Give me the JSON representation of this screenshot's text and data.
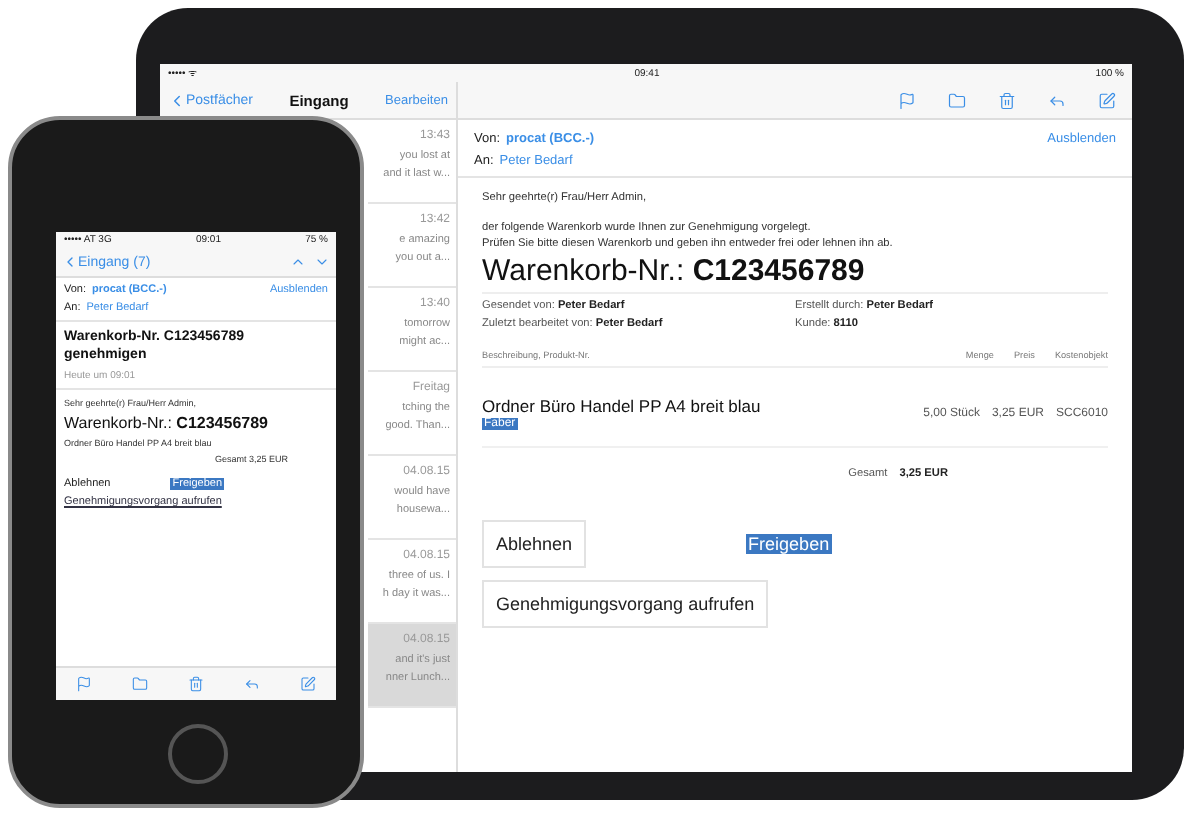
{
  "tablet": {
    "status_bar": {
      "signal": "••••• ᯤ",
      "time": "09:41",
      "battery": "100 %"
    },
    "mailbox": {
      "back": "Postfächer",
      "title": "Eingang",
      "edit": "Bearbeiten",
      "items": [
        {
          "time": "13:43",
          "lines": [
            "you lost at",
            "and it last w..."
          ],
          "selected": false
        },
        {
          "time": "13:42",
          "lines": [
            "e amazing",
            "you out a..."
          ],
          "selected": false
        },
        {
          "time": "13:40",
          "lines": [
            "tomorrow",
            "might ac..."
          ],
          "selected": false
        },
        {
          "time": "Freitag",
          "lines": [
            "tching the",
            "good. Than..."
          ],
          "selected": false
        },
        {
          "time": "04.08.15",
          "lines": [
            "would have",
            "housewa..."
          ],
          "selected": false
        },
        {
          "time": "04.08.15",
          "lines": [
            "three of us. I",
            "h day it was..."
          ],
          "selected": false
        },
        {
          "time": "04.08.15",
          "lines": [
            "and it's just",
            "nner Lunch..."
          ],
          "selected": true
        }
      ]
    },
    "message": {
      "from_label": "Von:",
      "from": "procat (BCC.-)",
      "hide": "Ausblenden",
      "to_label": "An:",
      "to": "Peter Bedarf",
      "greeting": "Sehr geehrte(r) Frau/Herr Admin,",
      "body": [
        "der folgende Warenkorb wurde Ihnen zur Genehmigung vorgelegt.",
        "Prüfen Sie bitte diesen Warenkorb und geben ihn entweder frei oder lehnen ihn ab."
      ],
      "heading": "Warenkorb-Nr.: **C123456789**",
      "meta": [
        {
          "label": "Gesendet von:",
          "value": "Peter Bedarf"
        },
        {
          "label": "Erstellt durch:",
          "value": "Peter Bedarf"
        },
        {
          "label": "Zuletzt bearbeitet von:",
          "value": "Peter Bedarf"
        },
        {
          "label": "Kunde:",
          "value": "8110"
        }
      ],
      "columns": [
        "Beschreibung, Produkt-Nr.",
        "Menge",
        "Preis",
        "Kostenobjekt"
      ],
      "row": {
        "description": "Ordner Büro Handel PP A4 breit blau",
        "tag": "Faber",
        "quantity": "5,00 Stück",
        "price": "3,25 EUR",
        "cost_object": "SCC6010"
      },
      "total_label": "Gesamt",
      "total": "3,25 EUR",
      "buttons": [
        {
          "label": "Ablehnen",
          "kind": "outlined"
        },
        {
          "label": "Freigeben",
          "kind": "highlighted"
        },
        {
          "label": "Genehmigungsvorgang aufrufen",
          "kind": "outlined"
        }
      ]
    }
  },
  "phone": {
    "status_bar": {
      "signal": "••••• AT 3G",
      "time": "09:01",
      "battery": "75 %"
    },
    "nav": {
      "back": "Eingang (7)"
    },
    "message": {
      "from_label": "Von:",
      "from": "procat (BCC.-)",
      "hide": "Ausblenden",
      "to_label": "An:",
      "to": "Peter Bedarf",
      "subject": "Warenkorb-Nr. C123456789 genehmigen",
      "date": "Heute um 09:01",
      "greeting": "Sehr geehrte(r) Frau/Herr Admin,",
      "heading": "Warenkorb-Nr.: **C123456789**",
      "row": "Ordner Büro Handel PP A4 breit blau",
      "total": "Gesamt 3,25 EUR",
      "buttons": [
        {
          "label": "Ablehnen",
          "kind": "plain"
        },
        {
          "label": "Freigeben",
          "kind": "highlighted"
        },
        {
          "label": "Genehmigungsvorgang aufrufen",
          "kind": "link"
        }
      ]
    }
  }
}
